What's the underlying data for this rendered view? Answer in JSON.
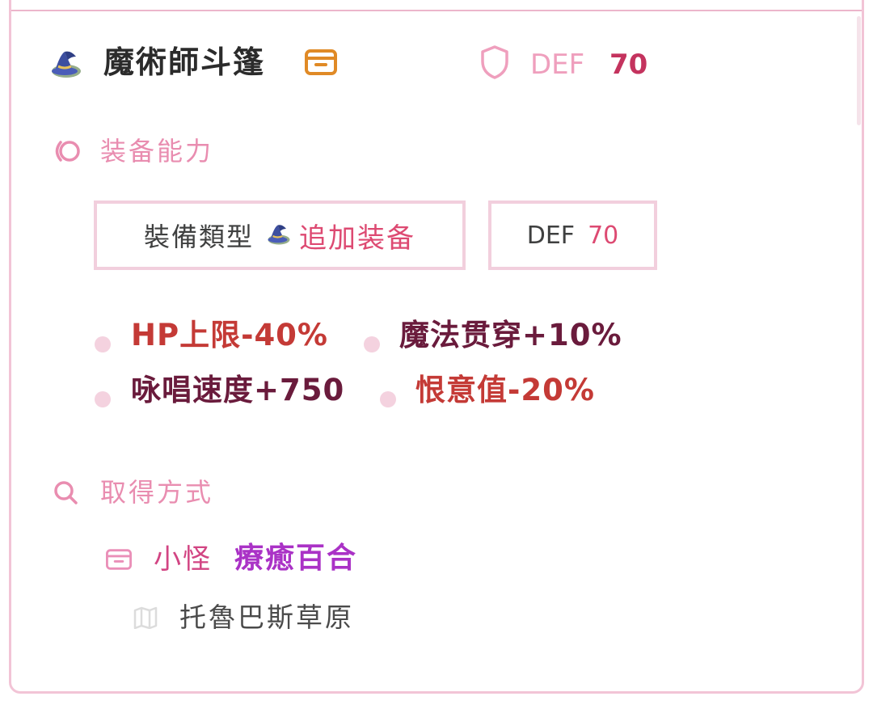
{
  "item": {
    "name": "魔術師斗篷",
    "def_label": "DEF",
    "def_value": "70",
    "icons": {
      "item": "wizard-hat-icon",
      "drop": "drop-box-icon",
      "defense": "shield-icon"
    }
  },
  "abilities": {
    "title": "装备能力",
    "icon": "swirl-icon",
    "chips": {
      "type_label": "裝備類型",
      "type_value": "追加装备",
      "def_label": "DEF",
      "def_value": "70"
    },
    "stats": [
      {
        "text": "HP上限-40%",
        "kind": "negative"
      },
      {
        "text": "魔法贯穿+10%",
        "kind": "positive"
      },
      {
        "text": "咏唱速度+750",
        "kind": "positive"
      },
      {
        "text": "恨意值-20%",
        "kind": "negative"
      }
    ]
  },
  "acquisition": {
    "title": "取得方式",
    "icon": "search-icon",
    "source_kind": "小怪",
    "source_name": "療癒百合",
    "location": "托魯巴斯草原",
    "icons": {
      "source": "drop-box-icon",
      "location": "map-icon"
    }
  },
  "colors": {
    "accent_pink": "#e98db0",
    "border_pink": "#f2c4d6",
    "negative": "#c43a36",
    "positive": "#6a1b3c",
    "monster": "#aa32c6"
  }
}
